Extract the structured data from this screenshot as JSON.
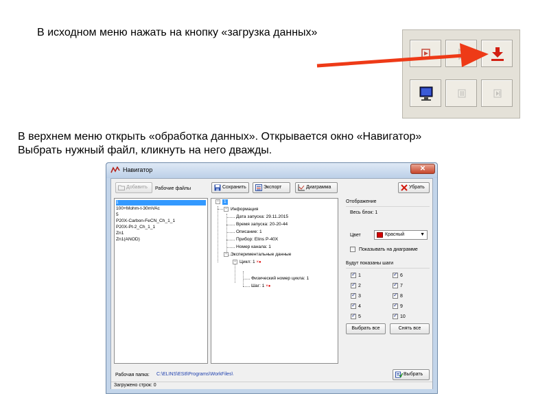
{
  "captions": {
    "line1": "В исходном меню нажать на кнопку «загрузка данных»",
    "line2": "В верхнем меню открыть «обработка данных». Открывается окно «Навигатор»",
    "line3": "Выбрать нужный файл, кликнуть на него дважды."
  },
  "colors": {
    "arrow": "#ee3a17",
    "title_bg": "#c3d5ea",
    "selection": "#3399ff",
    "path_text": "#1d3fae"
  },
  "toolbar_icons": [
    "record-icon",
    "play-icon",
    "download-data-icon",
    "monitor-icon",
    "pause-icon",
    "step-icon"
  ],
  "window": {
    "title": "Навигатор",
    "close_label": "✕",
    "add_button": "Добавить",
    "work_files_label": "Рабочие файлы",
    "save_button": "Сохранить",
    "export_button": "Экспорт",
    "chart_button": "Диаграмма",
    "remove_button": "Убрать",
    "files": [
      "1",
      "100+Mohm-t-30mVAc",
      "5",
      "P20X-Carbon-FeCN_Ch_1_1",
      "P20X-Pt-2_Ch_1_1",
      "Zn1",
      "Zn1(ANOD)"
    ],
    "tree": {
      "root": "1",
      "info": "Информация",
      "date": "Дата запуска: 29.11.2015",
      "time": "Время запуска: 20-20-44",
      "description": "Описание: 1",
      "device": "Прибор: Elins P-40X",
      "channel": "Номер канала: 1",
      "experimental": "Экспериментальные данные",
      "cycle": "Цикл: 1",
      "cycle_mark": "×●",
      "physical_cycle": "Физический номер цикла: 1",
      "step": "Шаг: 1",
      "step_mark": "×●"
    },
    "display": {
      "title": "Отображение",
      "whole_block": "Весь блок: 1",
      "color_label": "Цвет",
      "color_value": "Красный",
      "show_on_chart": "Показывать на диаграмме"
    },
    "steps": {
      "title": "Будут показаны шаги",
      "items": [
        "1",
        "2",
        "3",
        "4",
        "5",
        "6",
        "7",
        "8",
        "9",
        "10"
      ],
      "select_all": "Выбрать все",
      "clear_all": "Снять все"
    },
    "work_folder_label": "Рабочая папка:",
    "work_folder_path": "C:\\ELINS\\ES8\\Programs\\WorkFiles\\",
    "choose_button": "Выбрать",
    "status": "Загружено строк: 0"
  }
}
